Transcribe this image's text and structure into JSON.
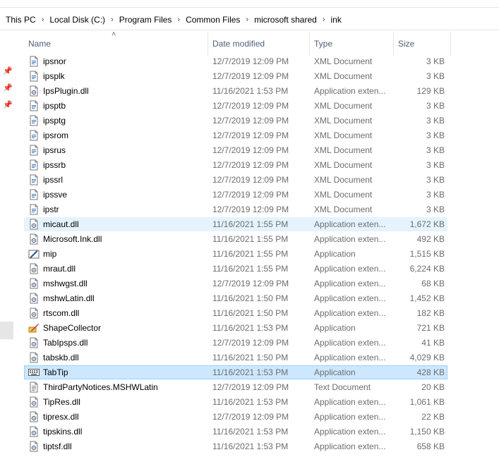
{
  "breadcrumb": [
    "This PC",
    "Local Disk (C:)",
    "Program Files",
    "Common Files",
    "microsoft shared",
    "ink"
  ],
  "columns": {
    "name": "Name",
    "date": "Date modified",
    "type": "Type",
    "size": "Size"
  },
  "sorted_column": "name",
  "colors": {
    "selected_bg": "#cce8ff",
    "selected_border": "#99d1ff",
    "hover_bg": "#e5f3ff",
    "header_text": "#4c607a",
    "secondary_text": "#6d6d6d"
  },
  "files": [
    {
      "name": "ipsnor",
      "date": "12/7/2019 12:09 PM",
      "type": "XML Document",
      "size": "3 KB",
      "icon": "xml-document-icon",
      "state": ""
    },
    {
      "name": "ipsplk",
      "date": "12/7/2019 12:09 PM",
      "type": "XML Document",
      "size": "3 KB",
      "icon": "xml-document-icon",
      "state": ""
    },
    {
      "name": "IpsPlugin.dll",
      "date": "11/16/2021 1:53 PM",
      "type": "Application exten...",
      "size": "129 KB",
      "icon": "dll-file-icon",
      "state": ""
    },
    {
      "name": "ipsptb",
      "date": "12/7/2019 12:09 PM",
      "type": "XML Document",
      "size": "3 KB",
      "icon": "xml-document-icon",
      "state": ""
    },
    {
      "name": "ipsptg",
      "date": "12/7/2019 12:09 PM",
      "type": "XML Document",
      "size": "3 KB",
      "icon": "xml-document-icon",
      "state": ""
    },
    {
      "name": "ipsrom",
      "date": "12/7/2019 12:09 PM",
      "type": "XML Document",
      "size": "3 KB",
      "icon": "xml-document-icon",
      "state": ""
    },
    {
      "name": "ipsrus",
      "date": "12/7/2019 12:09 PM",
      "type": "XML Document",
      "size": "3 KB",
      "icon": "xml-document-icon",
      "state": ""
    },
    {
      "name": "ipssrb",
      "date": "12/7/2019 12:09 PM",
      "type": "XML Document",
      "size": "3 KB",
      "icon": "xml-document-icon",
      "state": ""
    },
    {
      "name": "ipssrl",
      "date": "12/7/2019 12:09 PM",
      "type": "XML Document",
      "size": "3 KB",
      "icon": "xml-document-icon",
      "state": ""
    },
    {
      "name": "ipssve",
      "date": "12/7/2019 12:09 PM",
      "type": "XML Document",
      "size": "3 KB",
      "icon": "xml-document-icon",
      "state": ""
    },
    {
      "name": "ipstr",
      "date": "12/7/2019 12:09 PM",
      "type": "XML Document",
      "size": "3 KB",
      "icon": "xml-document-icon",
      "state": ""
    },
    {
      "name": "micaut.dll",
      "date": "11/16/2021 1:55 PM",
      "type": "Application exten...",
      "size": "1,672 KB",
      "icon": "dll-file-icon",
      "state": "hover"
    },
    {
      "name": "Microsoft.Ink.dll",
      "date": "11/16/2021 1:55 PM",
      "type": "Application exten...",
      "size": "492 KB",
      "icon": "dll-file-icon",
      "state": ""
    },
    {
      "name": "mip",
      "date": "11/16/2021 1:55 PM",
      "type": "Application",
      "size": "1,515 KB",
      "icon": "math-input-pen-icon",
      "state": ""
    },
    {
      "name": "mraut.dll",
      "date": "11/16/2021 1:55 PM",
      "type": "Application exten...",
      "size": "6,224 KB",
      "icon": "dll-file-icon",
      "state": ""
    },
    {
      "name": "mshwgst.dll",
      "date": "12/7/2019 12:09 PM",
      "type": "Application exten...",
      "size": "68 KB",
      "icon": "dll-file-icon",
      "state": ""
    },
    {
      "name": "mshwLatin.dll",
      "date": "11/16/2021 1:50 PM",
      "type": "Application exten...",
      "size": "1,452 KB",
      "icon": "dll-file-icon",
      "state": ""
    },
    {
      "name": "rtscom.dll",
      "date": "11/16/2021 1:50 PM",
      "type": "Application exten...",
      "size": "182 KB",
      "icon": "dll-file-icon",
      "state": ""
    },
    {
      "name": "ShapeCollector",
      "date": "11/16/2021 1:53 PM",
      "type": "Application",
      "size": "721 KB",
      "icon": "shape-collector-icon",
      "state": ""
    },
    {
      "name": "TabIpsps.dll",
      "date": "12/7/2019 12:09 PM",
      "type": "Application exten...",
      "size": "41 KB",
      "icon": "dll-file-icon",
      "state": ""
    },
    {
      "name": "tabskb.dll",
      "date": "11/16/2021 1:50 PM",
      "type": "Application exten...",
      "size": "4,029 KB",
      "icon": "dll-file-icon",
      "state": ""
    },
    {
      "name": "TabTip",
      "date": "11/16/2021 1:53 PM",
      "type": "Application",
      "size": "428 KB",
      "icon": "keyboard-icon",
      "state": "selected"
    },
    {
      "name": "ThirdPartyNotices.MSHWLatin",
      "date": "12/7/2019 12:09 PM",
      "type": "Text Document",
      "size": "20 KB",
      "icon": "text-document-icon",
      "state": ""
    },
    {
      "name": "TipRes.dll",
      "date": "11/16/2021 1:53 PM",
      "type": "Application exten...",
      "size": "1,061 KB",
      "icon": "dll-file-icon",
      "state": ""
    },
    {
      "name": "tipresx.dll",
      "date": "12/7/2019 12:09 PM",
      "type": "Application exten...",
      "size": "22 KB",
      "icon": "dll-file-icon",
      "state": ""
    },
    {
      "name": "tipskins.dll",
      "date": "11/16/2021 1:53 PM",
      "type": "Application exten...",
      "size": "1,150 KB",
      "icon": "dll-file-icon",
      "state": ""
    },
    {
      "name": "tiptsf.dll",
      "date": "11/16/2021 1:53 PM",
      "type": "Application exten...",
      "size": "658 KB",
      "icon": "dll-file-icon",
      "state": ""
    }
  ]
}
